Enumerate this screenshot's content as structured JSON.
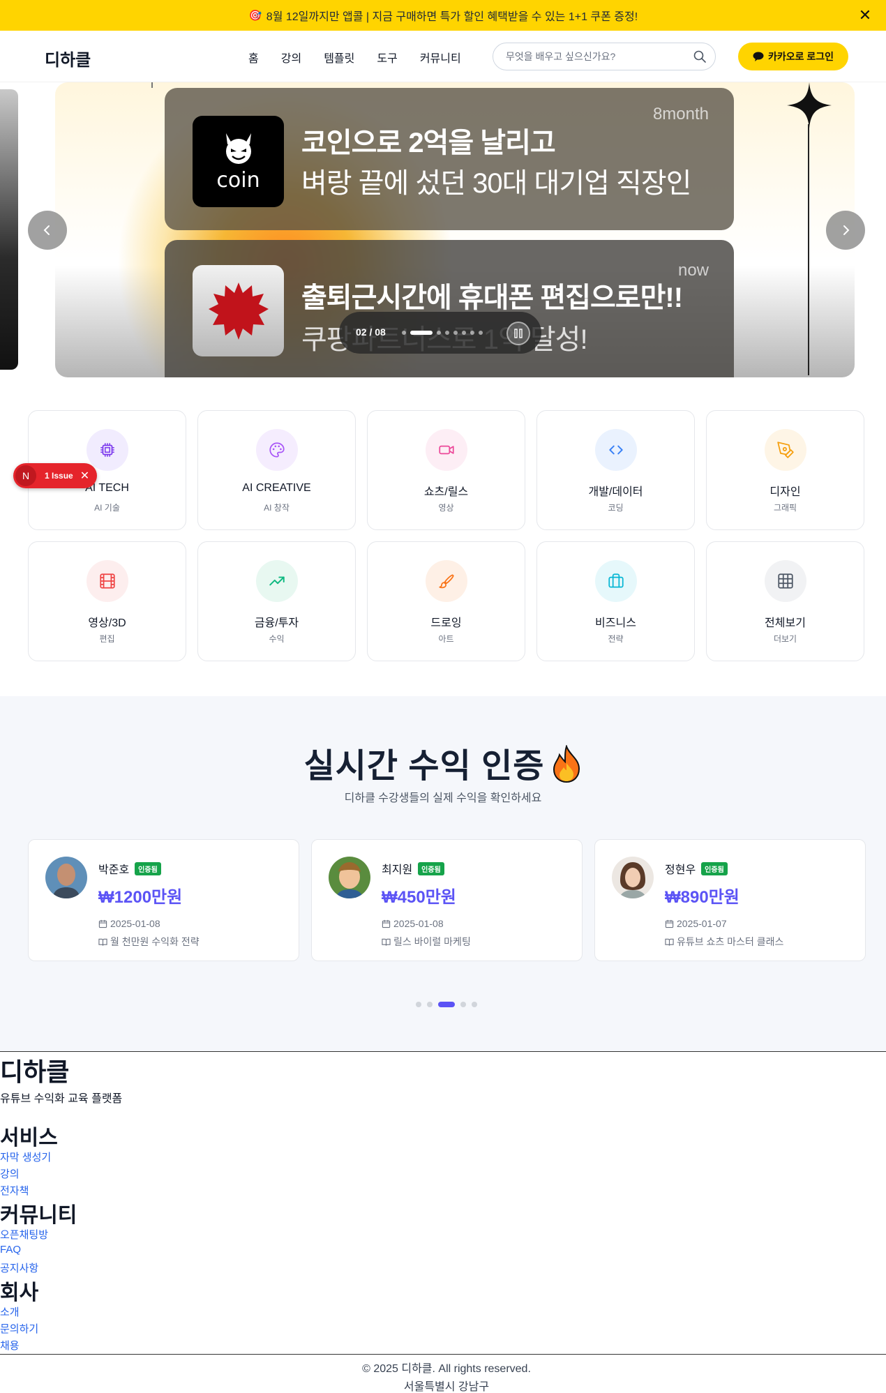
{
  "promo": {
    "emoji": "🎯",
    "text": "8월 12일까지만 앱콜 | 지금 구매하면 특가 할인 혜택받을 수 있는 1+1 쿠폰 증정!",
    "close_icon": "close-icon"
  },
  "header": {
    "logo": "디하클",
    "nav": [
      "홈",
      "강의",
      "템플릿",
      "도구",
      "커뮤니티"
    ],
    "search_placeholder": "무엇을 배우고 싶으신가요?",
    "login_label": "카카오로 로그인",
    "accent": "#ffd400"
  },
  "hero": {
    "cards": [
      {
        "thumb_text": "coin",
        "title": "코인으로 2억을 날리고",
        "subtitle": "벼랑 끝에 섰던 30대 대기업 직장인",
        "time": "8month"
      },
      {
        "title": "출퇴근시간에 휴대폰 편집으로만!!",
        "subtitle": "쿠팡파트너스로 1억 달성!",
        "time": "now"
      }
    ],
    "pager": {
      "current": "02 / 08",
      "total_dots": 8,
      "active_index": 1
    }
  },
  "categories": [
    {
      "name": "AI TECH",
      "sub": "AI 기술",
      "icon": "chip-icon",
      "color": "#7c3aed",
      "bg": "#f1ecfe"
    },
    {
      "name": "AI CREATIVE",
      "sub": "AI 창작",
      "icon": "palette-icon",
      "color": "#a855f7",
      "bg": "#f5edfe"
    },
    {
      "name": "쇼츠/릴스",
      "sub": "영상",
      "icon": "video-icon",
      "color": "#ec4899",
      "bg": "#fdeef5"
    },
    {
      "name": "개발/데이터",
      "sub": "코딩",
      "icon": "code-icon",
      "color": "#3b82f6",
      "bg": "#eaf2fe"
    },
    {
      "name": "디자인",
      "sub": "그래픽",
      "icon": "pen-tool-icon",
      "color": "#f59e0b",
      "bg": "#fef5e6"
    },
    {
      "name": "영상/3D",
      "sub": "편집",
      "icon": "film-icon",
      "color": "#ef4444",
      "bg": "#fdeeee"
    },
    {
      "name": "금융/투자",
      "sub": "수익",
      "icon": "trending-up-icon",
      "color": "#10b981",
      "bg": "#e8f8f1"
    },
    {
      "name": "드로잉",
      "sub": "아트",
      "icon": "brush-icon",
      "color": "#f97316",
      "bg": "#fef0e6"
    },
    {
      "name": "비즈니스",
      "sub": "전략",
      "icon": "briefcase-icon",
      "color": "#06b6d4",
      "bg": "#e6f8fb"
    },
    {
      "name": "전체보기",
      "sub": "더보기",
      "icon": "grid-icon",
      "color": "#4b5563",
      "bg": "#f1f2f4"
    }
  ],
  "issue_badge": {
    "letter": "N",
    "label": "1 Issue"
  },
  "earnings": {
    "title": "실시간 수익 인증",
    "subtitle": "디하클 수강생들의 실제 수익을 확인하세요",
    "verified_label": "인증됨",
    "items": [
      {
        "name": "박준호",
        "amount": "₩1200만원",
        "date": "2025-01-08",
        "course": "월 천만원 수익화 전략"
      },
      {
        "name": "최지원",
        "amount": "₩450만원",
        "date": "2025-01-08",
        "course": "릴스 바이럴 마케팅"
      },
      {
        "name": "정현우",
        "amount": "₩890만원",
        "date": "2025-01-07",
        "course": "유튜브 쇼츠 마스터 클래스"
      }
    ],
    "dots": 5,
    "active_dot": 2,
    "accent": "#5b53f5"
  },
  "footer": {
    "logo": "디하클",
    "tagline": "유튜브 수익화 교육 플랫폼",
    "sections": [
      {
        "title": "서비스",
        "links": [
          "자막 생성기",
          "강의",
          "전자책"
        ]
      },
      {
        "title": "커뮤니티",
        "links": [
          "오픈채팅방",
          "FAQ",
          "공지사항"
        ]
      },
      {
        "title": "회사",
        "links": [
          "소개",
          "문의하기",
          "채용"
        ]
      }
    ],
    "copyright": "© 2025 디하클. All rights reserved.",
    "address": "서울특별시 강남구"
  }
}
